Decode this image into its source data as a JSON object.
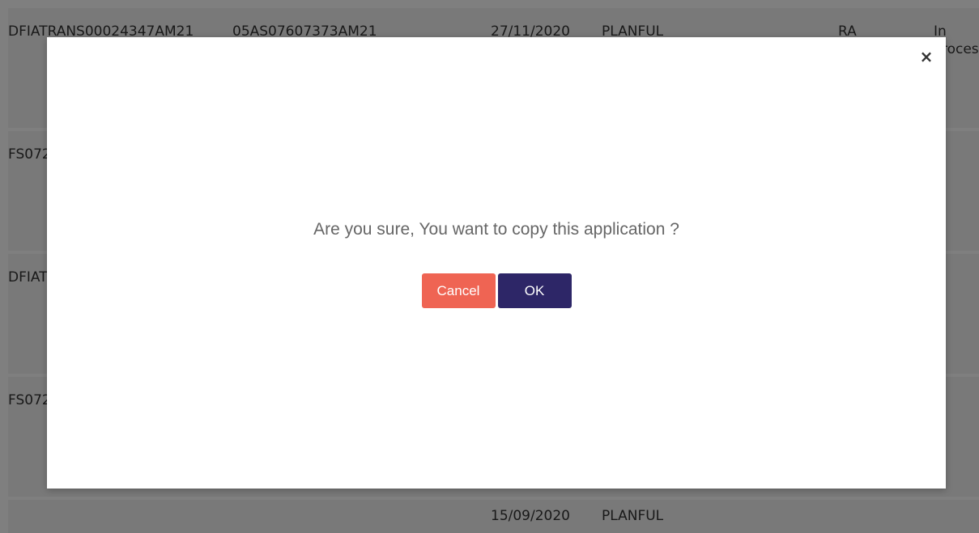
{
  "table": {
    "rows": [
      {
        "id": "DFIATRANS00024347AM21",
        "ref": "05AS07607373AM21",
        "date": "27/11/2020",
        "org": "PLANFUL",
        "type": "RA",
        "status": "In Process"
      },
      {
        "id": "FS072",
        "ref": "",
        "date": "",
        "org": "",
        "type": "",
        "status": ""
      },
      {
        "id": "DFIAT",
        "ref": "",
        "date": "",
        "org": "",
        "type": "",
        "status": ""
      },
      {
        "id": "FS072",
        "ref": "",
        "date": "",
        "org": "",
        "type": "",
        "status": ""
      },
      {
        "id": "",
        "ref": "",
        "date": "15/09/2020",
        "org": "PLANFUL",
        "type": "",
        "status": ""
      }
    ]
  },
  "dialog": {
    "close_symbol": "×",
    "message": "Are you sure, You want to copy this application ?",
    "cancel_label": "Cancel",
    "ok_label": "OK"
  },
  "colors": {
    "cancel_button": "#ef6453",
    "ok_button": "#2d2667",
    "overlay": "rgba(0,0,0,0.5)"
  }
}
